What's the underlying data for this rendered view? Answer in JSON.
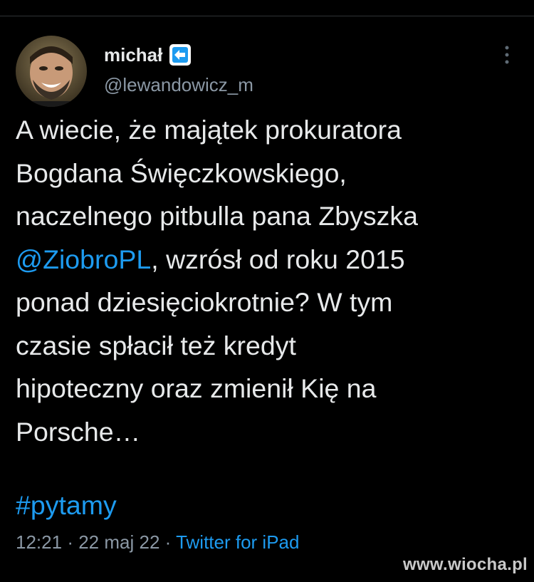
{
  "author": {
    "display_name": "michał",
    "handle": "@lewandowicz_m",
    "avatar_icon": "profile-photo",
    "badge_icon": "arrow-left-icon"
  },
  "tweet": {
    "lines": [
      "A wiecie, że majątek prokuratora",
      "Bogdana Święczkowskiego,",
      "naczelnego pitbulla pana Zbyszka",
      "ponad dziesięciokrotnie? W tym",
      "czasie spłacił też kredyt",
      "hipoteczny oraz zmienił Kię na",
      "Porsche…"
    ],
    "mention": "@ZiobroPL",
    "mention_line_rest": ", wzrósł od roku 2015",
    "hashtag": "#pytamy"
  },
  "meta": {
    "time": "12:21",
    "separator": "·",
    "date": "22 maj 22",
    "source": "Twitter for iPad"
  },
  "watermark": "www.wiocha.pl",
  "colors": {
    "background": "#000000",
    "text": "#e7e9ea",
    "secondary": "#8b98a5",
    "accent": "#1d9bf0"
  }
}
